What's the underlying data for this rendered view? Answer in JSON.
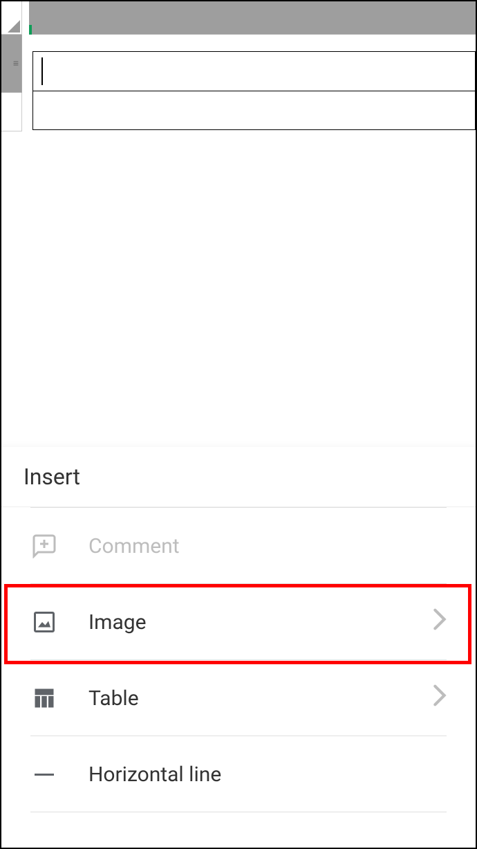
{
  "insert_panel": {
    "title": "Insert",
    "items": [
      {
        "label": "Comment",
        "icon": "comment-plus-icon",
        "disabled": true,
        "chevron": false
      },
      {
        "label": "Image",
        "icon": "image-icon",
        "disabled": false,
        "chevron": true,
        "highlighted": true
      },
      {
        "label": "Table",
        "icon": "table-icon",
        "disabled": false,
        "chevron": true
      },
      {
        "label": "Horizontal line",
        "icon": "horizontal-line-icon",
        "disabled": false,
        "chevron": false
      }
    ]
  }
}
